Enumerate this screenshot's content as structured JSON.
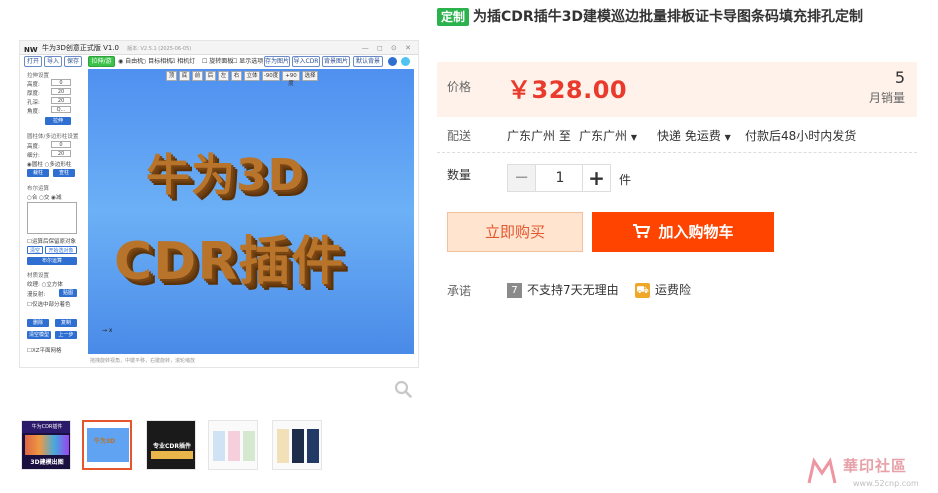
{
  "gallery": {
    "app": {
      "logo": "NW",
      "title": "牛为3D创意正式版 V1.0",
      "version": "版本: V2.5.1 (2025-06-05)",
      "window_controls": "— ◻ ⊙ ✕",
      "toolbar": {
        "open": "打开",
        "import": "导入",
        "save": "保存",
        "extrude": "拉伸/游标",
        "free_mode": "自由机",
        "orbit_camera": "目标相机",
        "relative_light": "相机灯",
        "rotate_panel": "旋转面板",
        "show_selected": "显示选项",
        "save_as_image": "存为图片",
        "import_cdr": "导入CDR",
        "bg_image": "背景图片",
        "default_bg": "默认背景"
      },
      "side": {
        "extrude_section": "拉伸设置",
        "height_label": "高度:",
        "height": "0",
        "depth_label": "厚度:",
        "depth": "20",
        "bevel_label": "孔深:",
        "bevel": "20",
        "angle_label": "角度:",
        "angle": "Q...",
        "extrude_btn": "拉伸",
        "boolean_section": "圆柱体/多边形柱设置",
        "radius_label": "高度:",
        "radius": "0",
        "segments_label": "细分:",
        "segments": "20",
        "round_label": "圆柱",
        "poly_label": "多边形柱",
        "cut_btn": "裁柱",
        "cut2_btn": "查柱",
        "bool_section": "布尔运算",
        "union": "合",
        "intersect": "交",
        "subtract": "减",
        "keep_label": "运算后保留原对象",
        "clear_btn": "清空",
        "pick_btn": "开始选对象",
        "bool_run": "布尔运算",
        "material_section": "材质设置",
        "texture_label": "纹理:",
        "cube_label": "立方体",
        "reflect_label": "漫反射:",
        "apply_btn": "贴图",
        "only_label": "仅选中部分着色",
        "delete_btn": "删除",
        "copy_btn": "复制",
        "clean_btn": "清空模型",
        "undo_btn": "上一步",
        "grid_label": "XZ平面网格"
      },
      "views": [
        "顶",
        "底",
        "前",
        "后",
        "左",
        "右",
        "立体",
        "-90度",
        "+90度",
        "选择"
      ],
      "scene_line1": "牛为3D",
      "scene_line2": "CDR插件",
      "axis": "→ x",
      "status": "拖拽旋转视角，中键平移，右键旋转，滚轮缩放"
    },
    "zoom_icon": "magnifier",
    "thumbnails": [
      {
        "label": "3D建模出图"
      },
      {
        "label": "牛为3D"
      },
      {
        "label": "专业CDR插件"
      },
      {
        "label": ""
      },
      {
        "label": ""
      }
    ]
  },
  "product": {
    "tag": "定制",
    "title": "为插CDR插牛3D建模巡边批量排板证卡导图条码填充排孔定制",
    "price_label": "价格",
    "price": "￥328.00",
    "sales_count": "5",
    "sales_label": "月销量",
    "shipping_label": "配送",
    "shipping_from": "广东广州",
    "shipping_to_word": "至",
    "shipping_to": "广东广州",
    "shipping_method": "快递 免运费",
    "shipping_note": "付款后48小时内发货",
    "quantity_label": "数量",
    "quantity": "1",
    "quantity_unit": "件",
    "buy_now": "立即购买",
    "add_to_cart": "加入购物车",
    "promise_label": "承诺",
    "promise_1": "不支持7天无理由",
    "promise_2": "运费险"
  },
  "watermark": {
    "cn": "華印社區",
    "url": "www.52cnp.com"
  },
  "colors": {
    "price": "#e93b2d",
    "cart": "#ff4400",
    "tag": "#2bb24c"
  }
}
